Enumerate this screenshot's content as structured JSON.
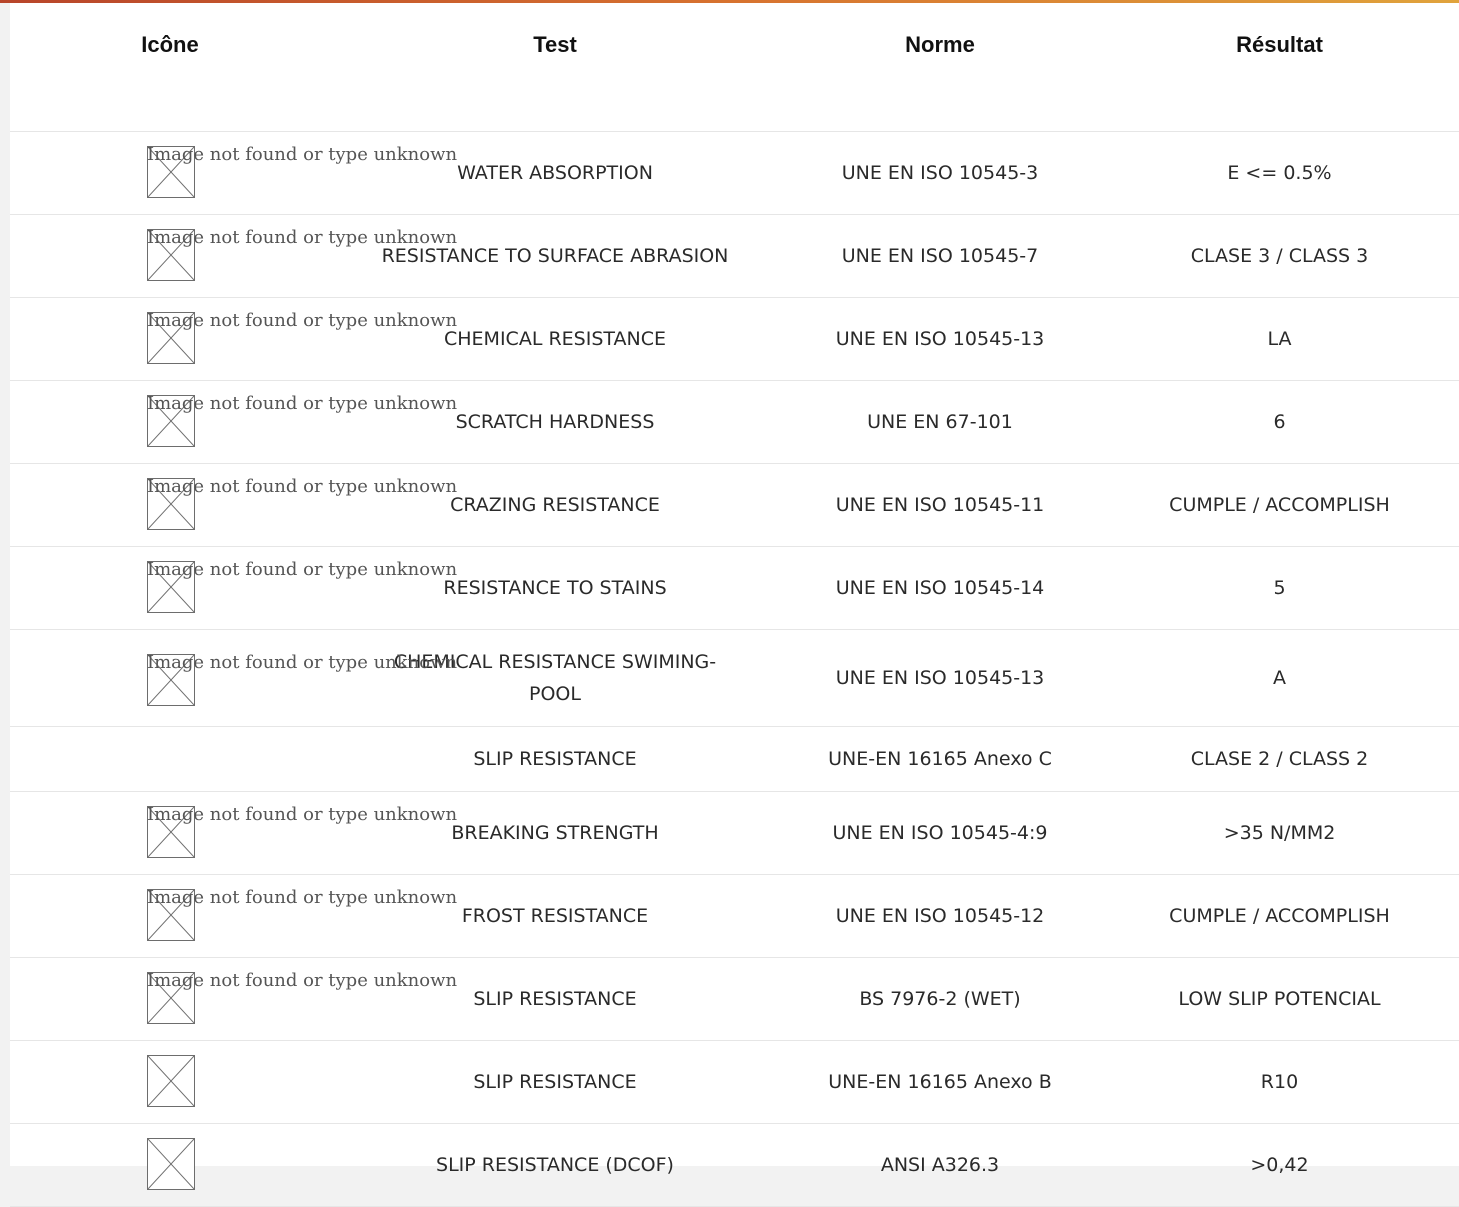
{
  "table": {
    "headers": [
      "Icône",
      "Test",
      "Norme",
      "Résultat"
    ],
    "broken_image_alt": "Image not found or type unknown",
    "rows": [
      {
        "test": "WATER ABSORPTION",
        "norm": "UNE EN ISO 10545-3",
        "result": "E <= 0.5%"
      },
      {
        "test": "RESISTANCE TO SURFACE ABRASION",
        "norm": "UNE EN ISO 10545-7",
        "result": "CLASE 3 / CLASS 3"
      },
      {
        "test": "CHEMICAL RESISTANCE",
        "norm": "UNE EN ISO 10545-13",
        "result": "LA"
      },
      {
        "test": "SCRATCH HARDNESS",
        "norm": "UNE EN 67-101",
        "result": "6"
      },
      {
        "test": "CRAZING RESISTANCE",
        "norm": "UNE EN ISO 10545-11",
        "result": "CUMPLE / ACCOMPLISH"
      },
      {
        "test": "RESISTANCE TO STAINS",
        "norm": "UNE EN ISO 10545-14",
        "result": "5"
      },
      {
        "test": "CHEMICAL RESISTANCE SWIMING-POOL",
        "norm": "UNE EN ISO 10545-13",
        "result": "A"
      },
      {
        "test": "SLIP RESISTANCE",
        "norm": "UNE-EN 16165 Anexo C",
        "result": "CLASE 2 / CLASS 2"
      },
      {
        "test": "BREAKING STRENGTH",
        "norm": "UNE EN ISO 10545-4:9",
        "result": ">35 N/MM2"
      },
      {
        "test": "FROST RESISTANCE",
        "norm": "UNE EN ISO 10545-12",
        "result": "CUMPLE / ACCOMPLISH"
      },
      {
        "test": "SLIP RESISTANCE",
        "norm": "BS 7976-2 (WET)",
        "result": "LOW SLIP POTENCIAL"
      },
      {
        "test": "SLIP RESISTANCE",
        "norm": "UNE-EN 16165 Anexo B",
        "result": "R10"
      },
      {
        "test": "SLIP RESISTANCE (DCOF)",
        "norm": "ANSI A326.3",
        "result": ">0,42"
      }
    ]
  },
  "colors": {
    "accent_start": "#b8452a",
    "accent_end": "#e0a33c"
  }
}
